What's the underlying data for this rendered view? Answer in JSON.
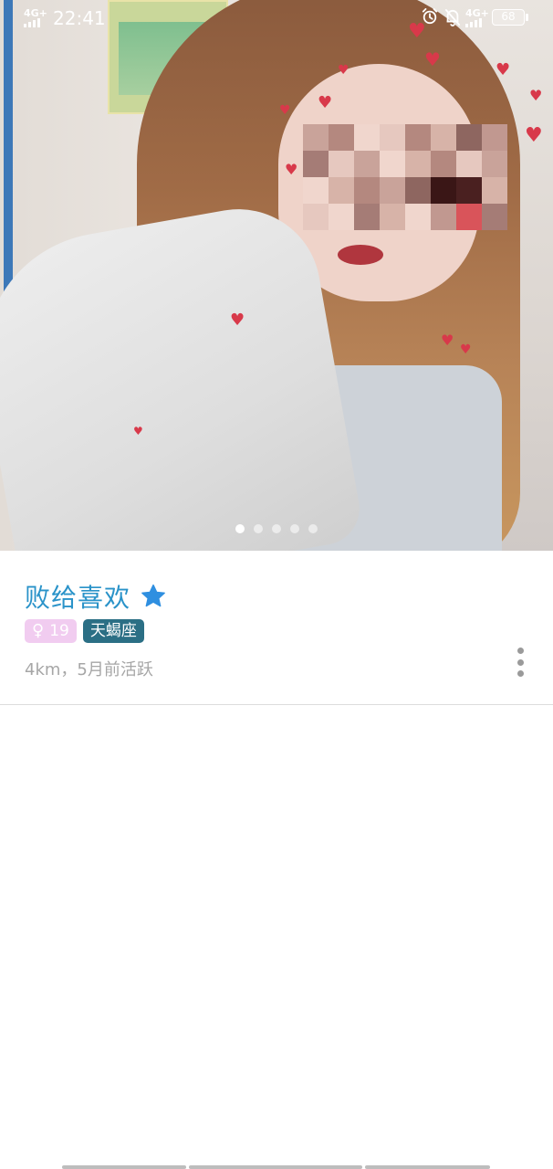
{
  "status_bar": {
    "time": "22:41",
    "network_left": "4G+",
    "network_right": "4G+",
    "battery": "68"
  },
  "photo": {
    "pages": 5,
    "active_page": 1
  },
  "profile": {
    "name": "败给喜欢",
    "gender_symbol": "♀",
    "age": "19",
    "zodiac": "天蝎座",
    "meta": "4km，5月前活跃"
  },
  "colors": {
    "name_blue": "#2a93c9",
    "star_blue": "#2f8fe0",
    "gender_pink": "#f1ccf0",
    "zodiac_teal": "#2b6f85",
    "meta_gray": "#a6a6a6"
  }
}
